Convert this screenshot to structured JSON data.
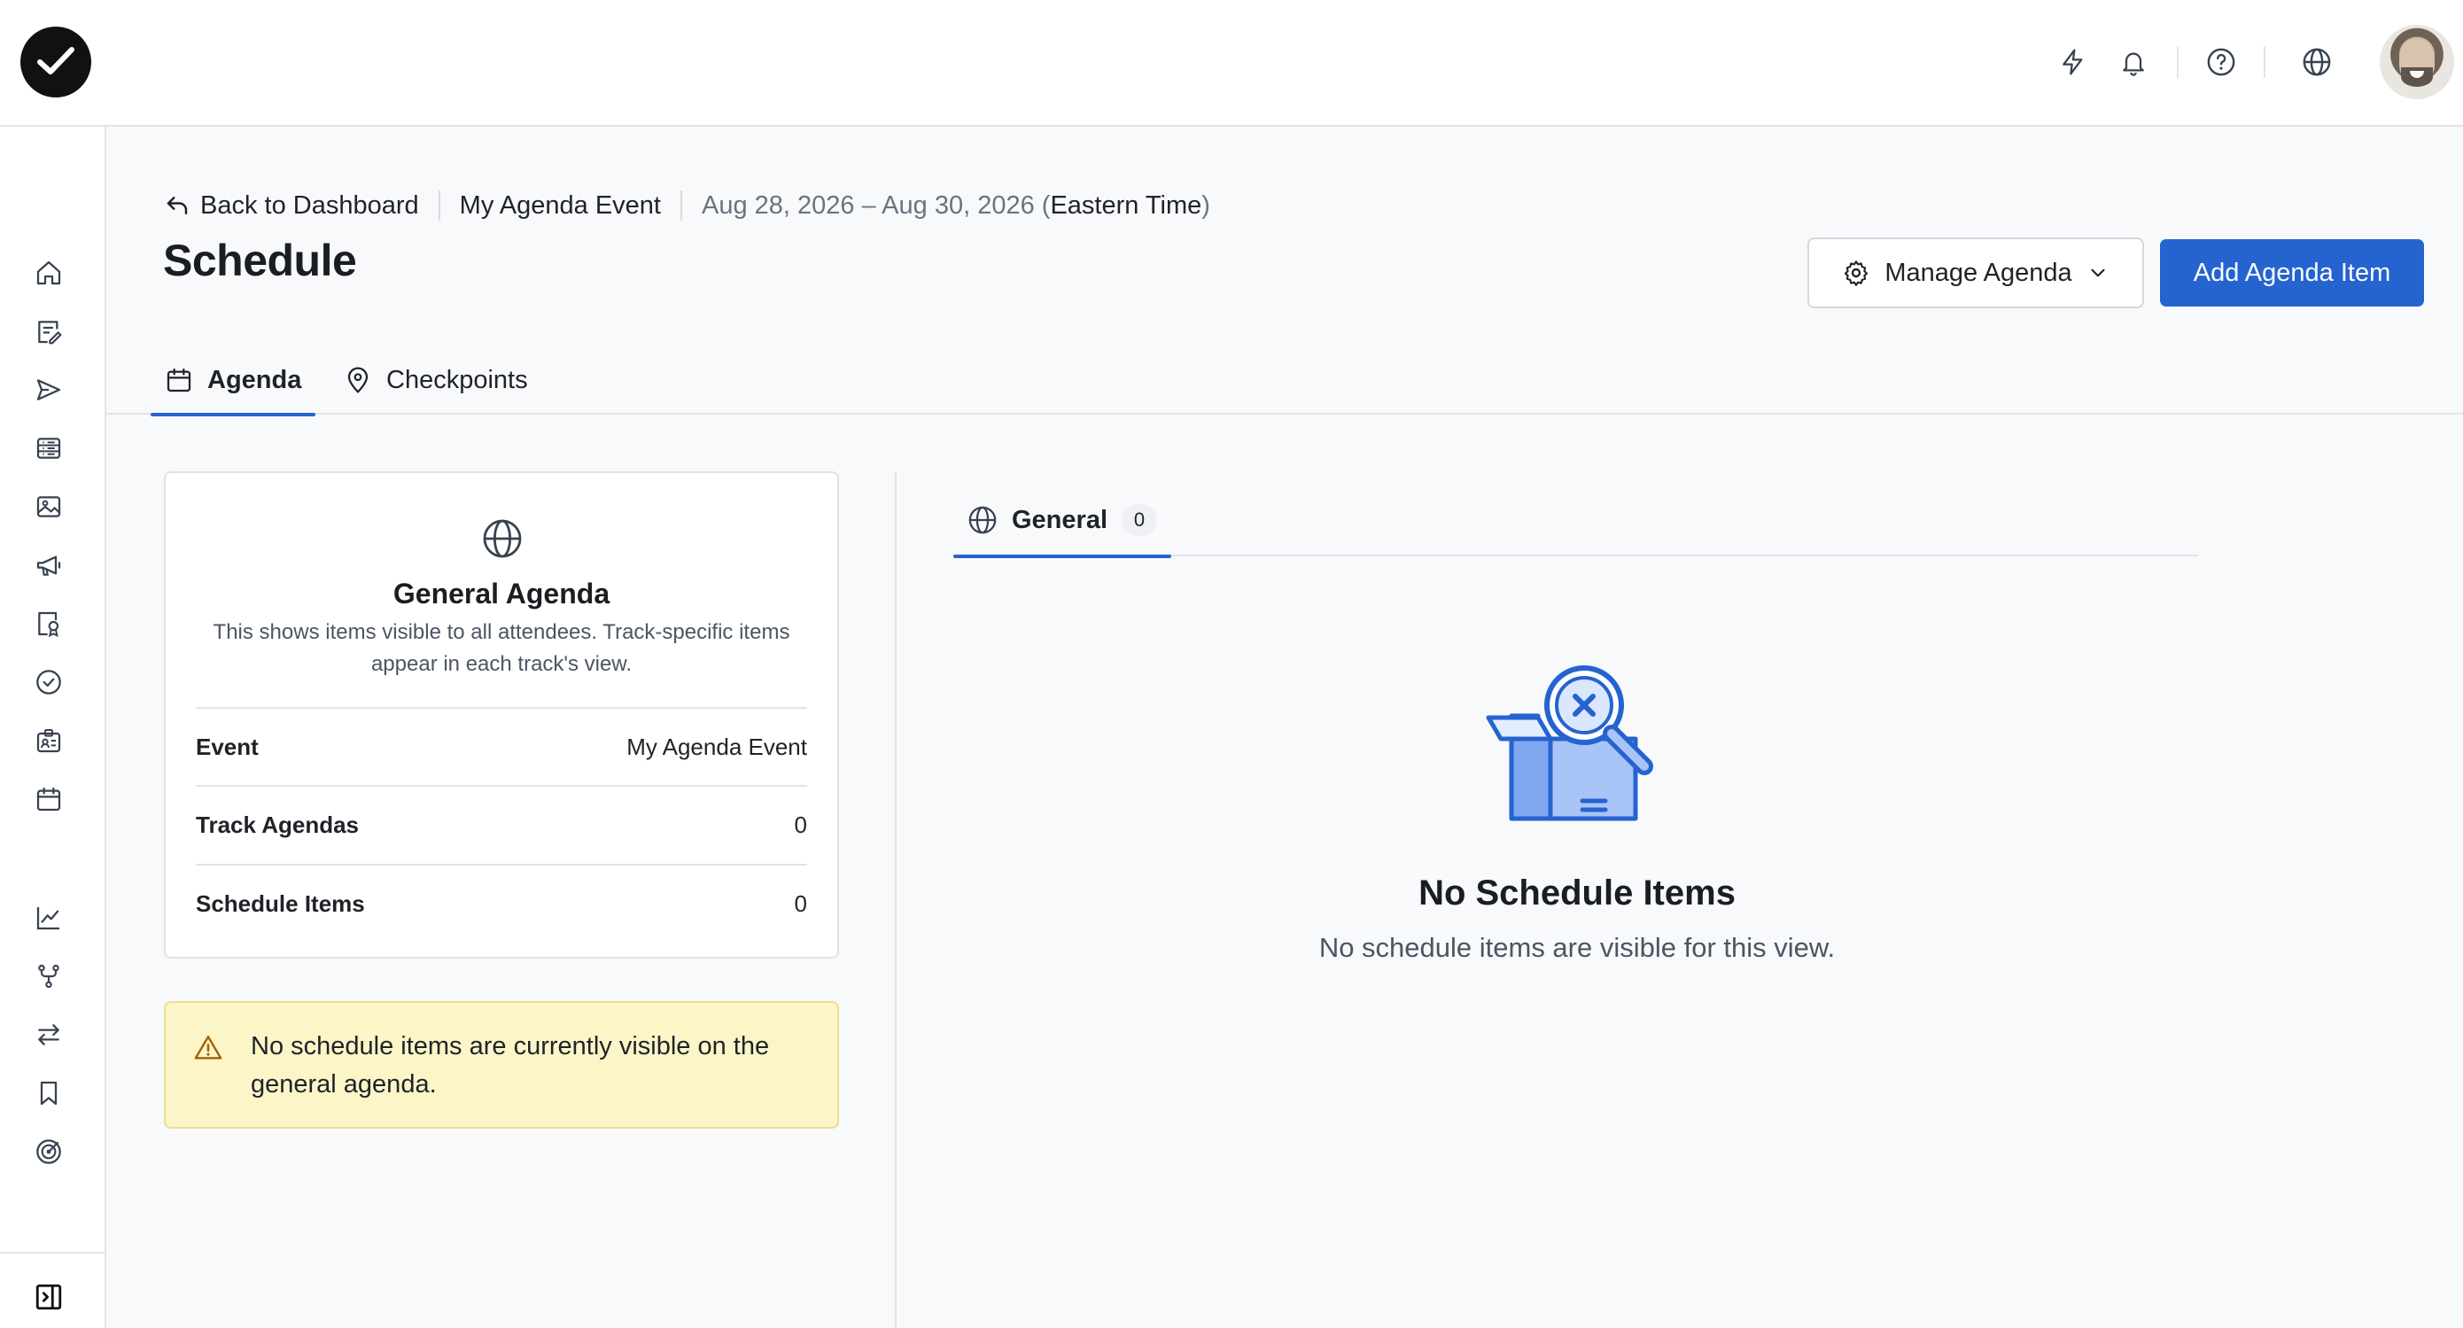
{
  "topbar": {
    "icons": [
      "logo-check-icon",
      "lightning-icon",
      "bell-icon",
      "help-icon",
      "globe-icon",
      "avatar"
    ]
  },
  "sidebar": {
    "items": [
      "home-icon",
      "edit-list-icon",
      "send-icon",
      "list-icon",
      "image-icon",
      "megaphone-icon",
      "badge-search-icon",
      "check-circle-icon",
      "id-card-icon",
      "calendar-icon",
      "chart-icon",
      "branch-icon",
      "swap-icon",
      "bookmark-icon",
      "target-icon"
    ],
    "collapse_icon": "sidebar-toggle-icon"
  },
  "breadcrumb": {
    "back_label": "Back to Dashboard",
    "event_name": "My Agenda Event",
    "dates": "Aug 28, 2026 – Aug 30, 2026 (",
    "timezone": "Eastern Time",
    "close_paren": ")"
  },
  "page": {
    "title": "Schedule"
  },
  "actions": {
    "manage_label": "Manage Agenda",
    "add_label": "Add Agenda Item"
  },
  "tabs": [
    {
      "label": "Agenda",
      "icon": "calendar-icon",
      "active": true
    },
    {
      "label": "Checkpoints",
      "icon": "map-pin-icon",
      "active": false
    }
  ],
  "card": {
    "title": "General Agenda",
    "description": "This shows items visible to all attendees. Track-specific items appear in each track's view.",
    "rows": [
      {
        "key": "Event",
        "value": "My Agenda Event"
      },
      {
        "key": "Track Agendas",
        "value": "0"
      },
      {
        "key": "Schedule Items",
        "value": "0"
      }
    ]
  },
  "warning": {
    "text": "No schedule items are currently visible on the general agenda."
  },
  "right_tabs": [
    {
      "label": "General",
      "count": "0"
    }
  ],
  "empty_state": {
    "title": "No Schedule Items",
    "subtitle": "No schedule items are visible for this view."
  },
  "colors": {
    "primary": "#2563cf",
    "warning_bg": "#fcf5c7",
    "warning_icon": "#a16207"
  }
}
